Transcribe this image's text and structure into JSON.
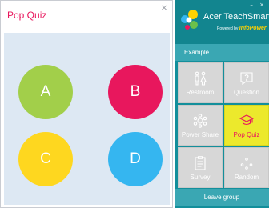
{
  "quiz": {
    "title": "Pop Quiz",
    "close_glyph": "×",
    "options": [
      {
        "label": "A",
        "color": "#a2cf4a"
      },
      {
        "label": "B",
        "color": "#e8175d"
      },
      {
        "label": "C",
        "color": "#fed71f"
      },
      {
        "label": "D",
        "color": "#35b6f0"
      }
    ]
  },
  "panel": {
    "brand": "Acer TeachSmart",
    "powered_by": "Powered by",
    "powered_brand": "InfoPower",
    "window_controls": "– ×",
    "section_title": "Example",
    "tiles": [
      {
        "label": "Restroom",
        "icon": "restroom-icon"
      },
      {
        "label": "Question",
        "icon": "question-icon"
      },
      {
        "label": "Power Share",
        "icon": "power-share-icon"
      },
      {
        "label": "Pop Quiz",
        "icon": "graduation-cap-icon",
        "active": true
      },
      {
        "label": "Survey",
        "icon": "survey-icon"
      },
      {
        "label": "Random",
        "icon": "random-icon"
      }
    ],
    "leave_label": "Leave group"
  },
  "colors": {
    "accent_pink": "#e8175d",
    "panel_teal": "#138f9b",
    "panel_teal_light": "#3aa7b3",
    "tile_gray": "#d7d7d7",
    "tile_active": "#ece92c",
    "quiz_background": "#dde8f3"
  }
}
